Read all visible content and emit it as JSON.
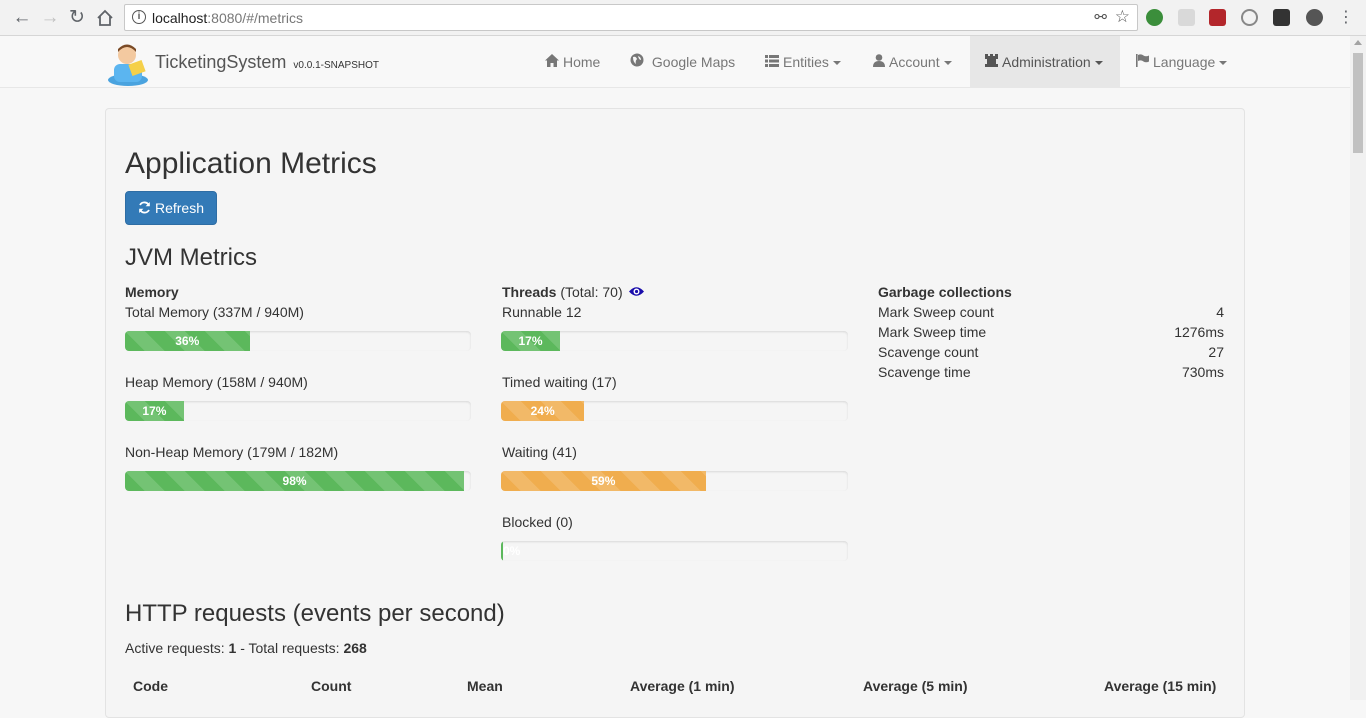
{
  "browser": {
    "url_host": "localhost",
    "url_rest": ":8080/#/metrics"
  },
  "navbar": {
    "brand": "TicketingSystem",
    "version": "v0.0.1-SNAPSHOT",
    "items": [
      {
        "label": "Home",
        "icon": "home-icon"
      },
      {
        "label": "Google Maps",
        "icon": "globe-icon"
      },
      {
        "label": "Entities",
        "icon": "list-icon"
      },
      {
        "label": "Account",
        "icon": "user-icon"
      },
      {
        "label": "Administration",
        "icon": "tower-icon"
      },
      {
        "label": "Language",
        "icon": "flag-icon"
      }
    ]
  },
  "page": {
    "title": "Application Metrics",
    "refresh_label": "Refresh"
  },
  "jvm": {
    "title": "JVM Metrics",
    "memory": {
      "heading": "Memory",
      "total": {
        "label": "Total Memory (337M / 940M)",
        "percent": 36,
        "text": "36%"
      },
      "heap": {
        "label": "Heap Memory (158M / 940M)",
        "percent": 17,
        "text": "17%"
      },
      "nonheap": {
        "label": "Non-Heap Memory (179M / 182M)",
        "percent": 98,
        "text": "98%"
      }
    },
    "threads": {
      "heading": "Threads",
      "total": "(Total: 70)",
      "runnable": {
        "label": "Runnable 12",
        "percent": 17,
        "text": "17%"
      },
      "timed_waiting": {
        "label": "Timed waiting (17)",
        "percent": 24,
        "text": "24%"
      },
      "waiting": {
        "label": "Waiting (41)",
        "percent": 59,
        "text": "59%"
      },
      "blocked": {
        "label": "Blocked (0)",
        "percent": 0,
        "text": "0%"
      }
    },
    "gc": {
      "heading": "Garbage collections",
      "rows": [
        {
          "label": "Mark Sweep count",
          "value": "4"
        },
        {
          "label": "Mark Sweep time",
          "value": "1276ms"
        },
        {
          "label": "Scavenge count",
          "value": "27"
        },
        {
          "label": "Scavenge time",
          "value": "730ms"
        }
      ]
    }
  },
  "http": {
    "title": "HTTP requests (events per second)",
    "active_label": "Active requests:",
    "active_value": "1",
    "total_label": "- Total requests:",
    "total_value": "268",
    "columns": [
      "Code",
      "Count",
      "Mean",
      "Average (1 min)",
      "Average (5 min)",
      "Average (15 min)"
    ]
  },
  "colors": {
    "primary": "#337ab7",
    "success": "#5cb85c",
    "warning": "#f0ad4e"
  }
}
